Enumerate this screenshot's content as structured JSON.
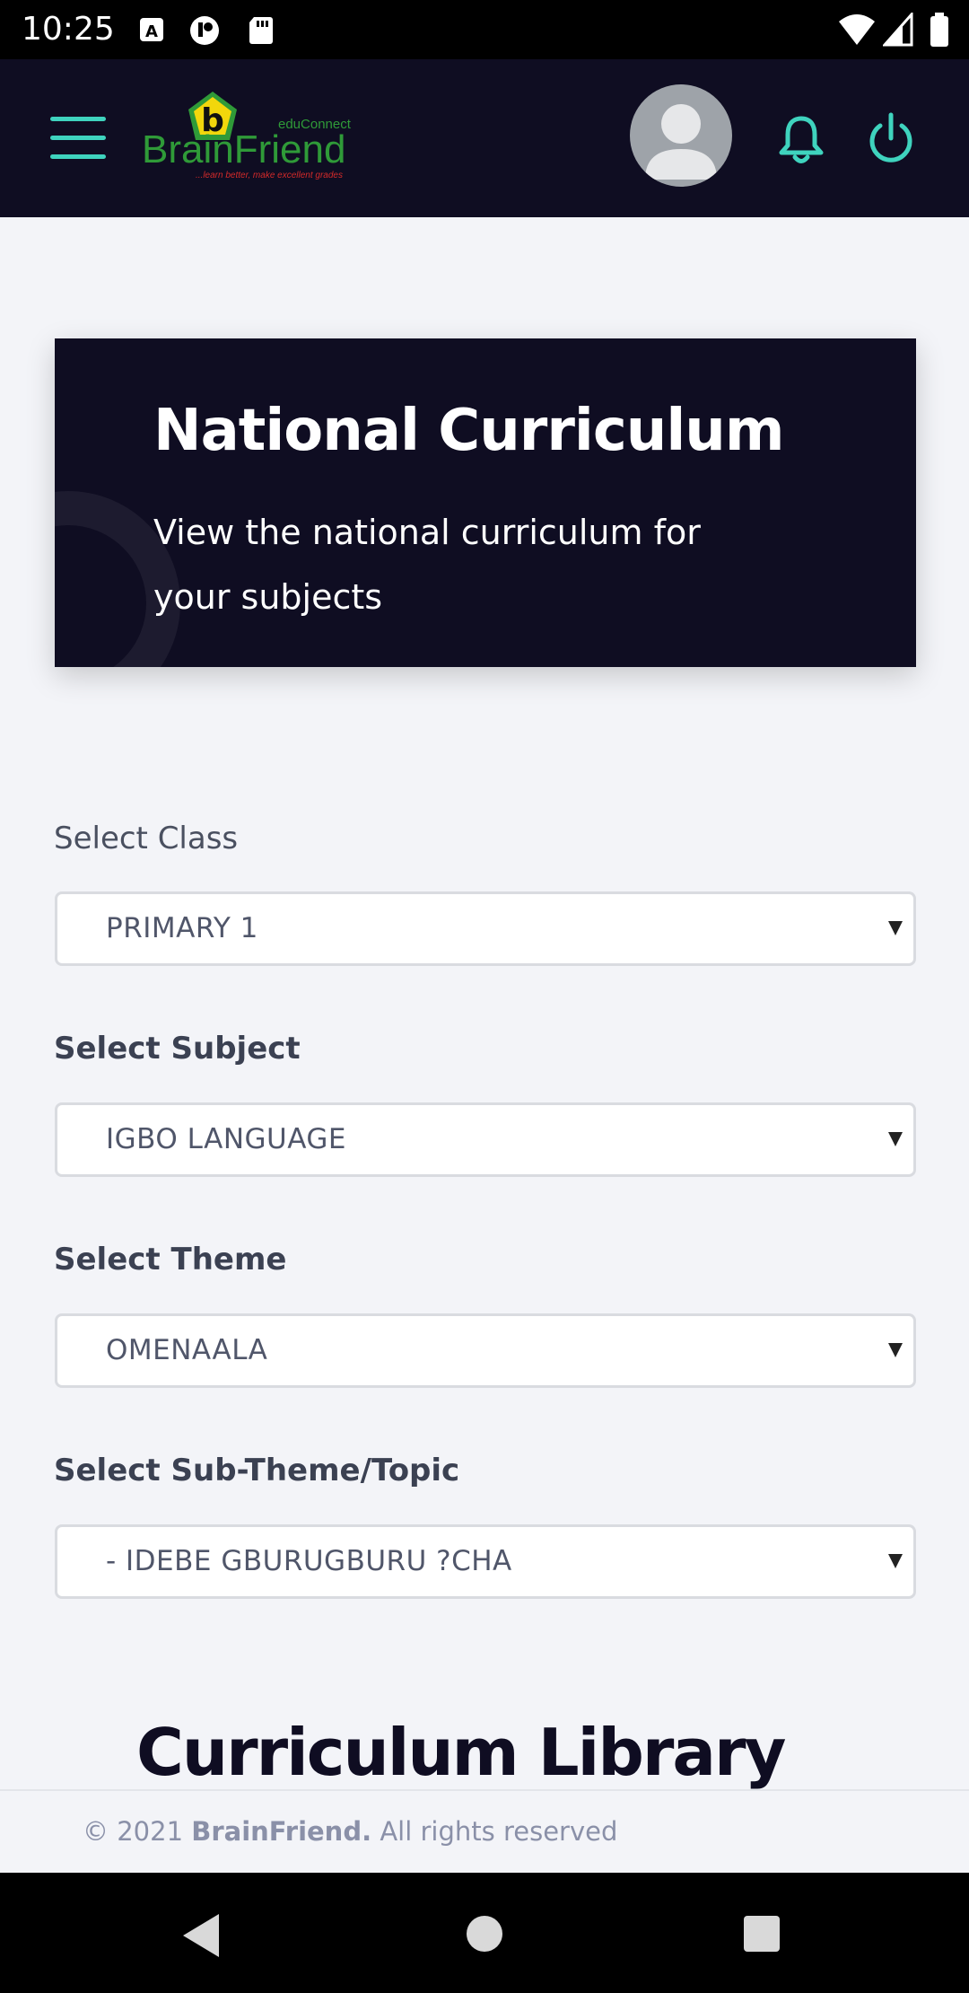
{
  "status_bar": {
    "time": "10:25",
    "icons": [
      "a-badge-icon",
      "podcast-icon",
      "sd-card-icon",
      "wifi-icon",
      "signal-icon",
      "battery-icon"
    ]
  },
  "header": {
    "logo_brand": "BrainFriend",
    "logo_small": "eduConnect",
    "logo_tagline": "...learn better, make excellent grades",
    "logo_letter": "b",
    "accent_color": "#3fd3be",
    "background_color": "#0f0d22"
  },
  "hero": {
    "title": "National Curriculum",
    "subtitle": "View the national curriculum for your subjects"
  },
  "form": {
    "class_label": "Select Class",
    "class_value": "PRIMARY 1",
    "subject_label": "Select Subject",
    "subject_value": "IGBO LANGUAGE",
    "theme_label": "Select Theme",
    "theme_value": "OMENAALA",
    "subtheme_label": "Select Sub-Theme/Topic",
    "subtheme_value": "- IDEBE GBURUGBURU ?CHA"
  },
  "library": {
    "title": "Curriculum Library"
  },
  "footer": {
    "prefix": "© 2021 ",
    "brand": "BrainFriend.",
    "suffix": " All rights reserved"
  }
}
